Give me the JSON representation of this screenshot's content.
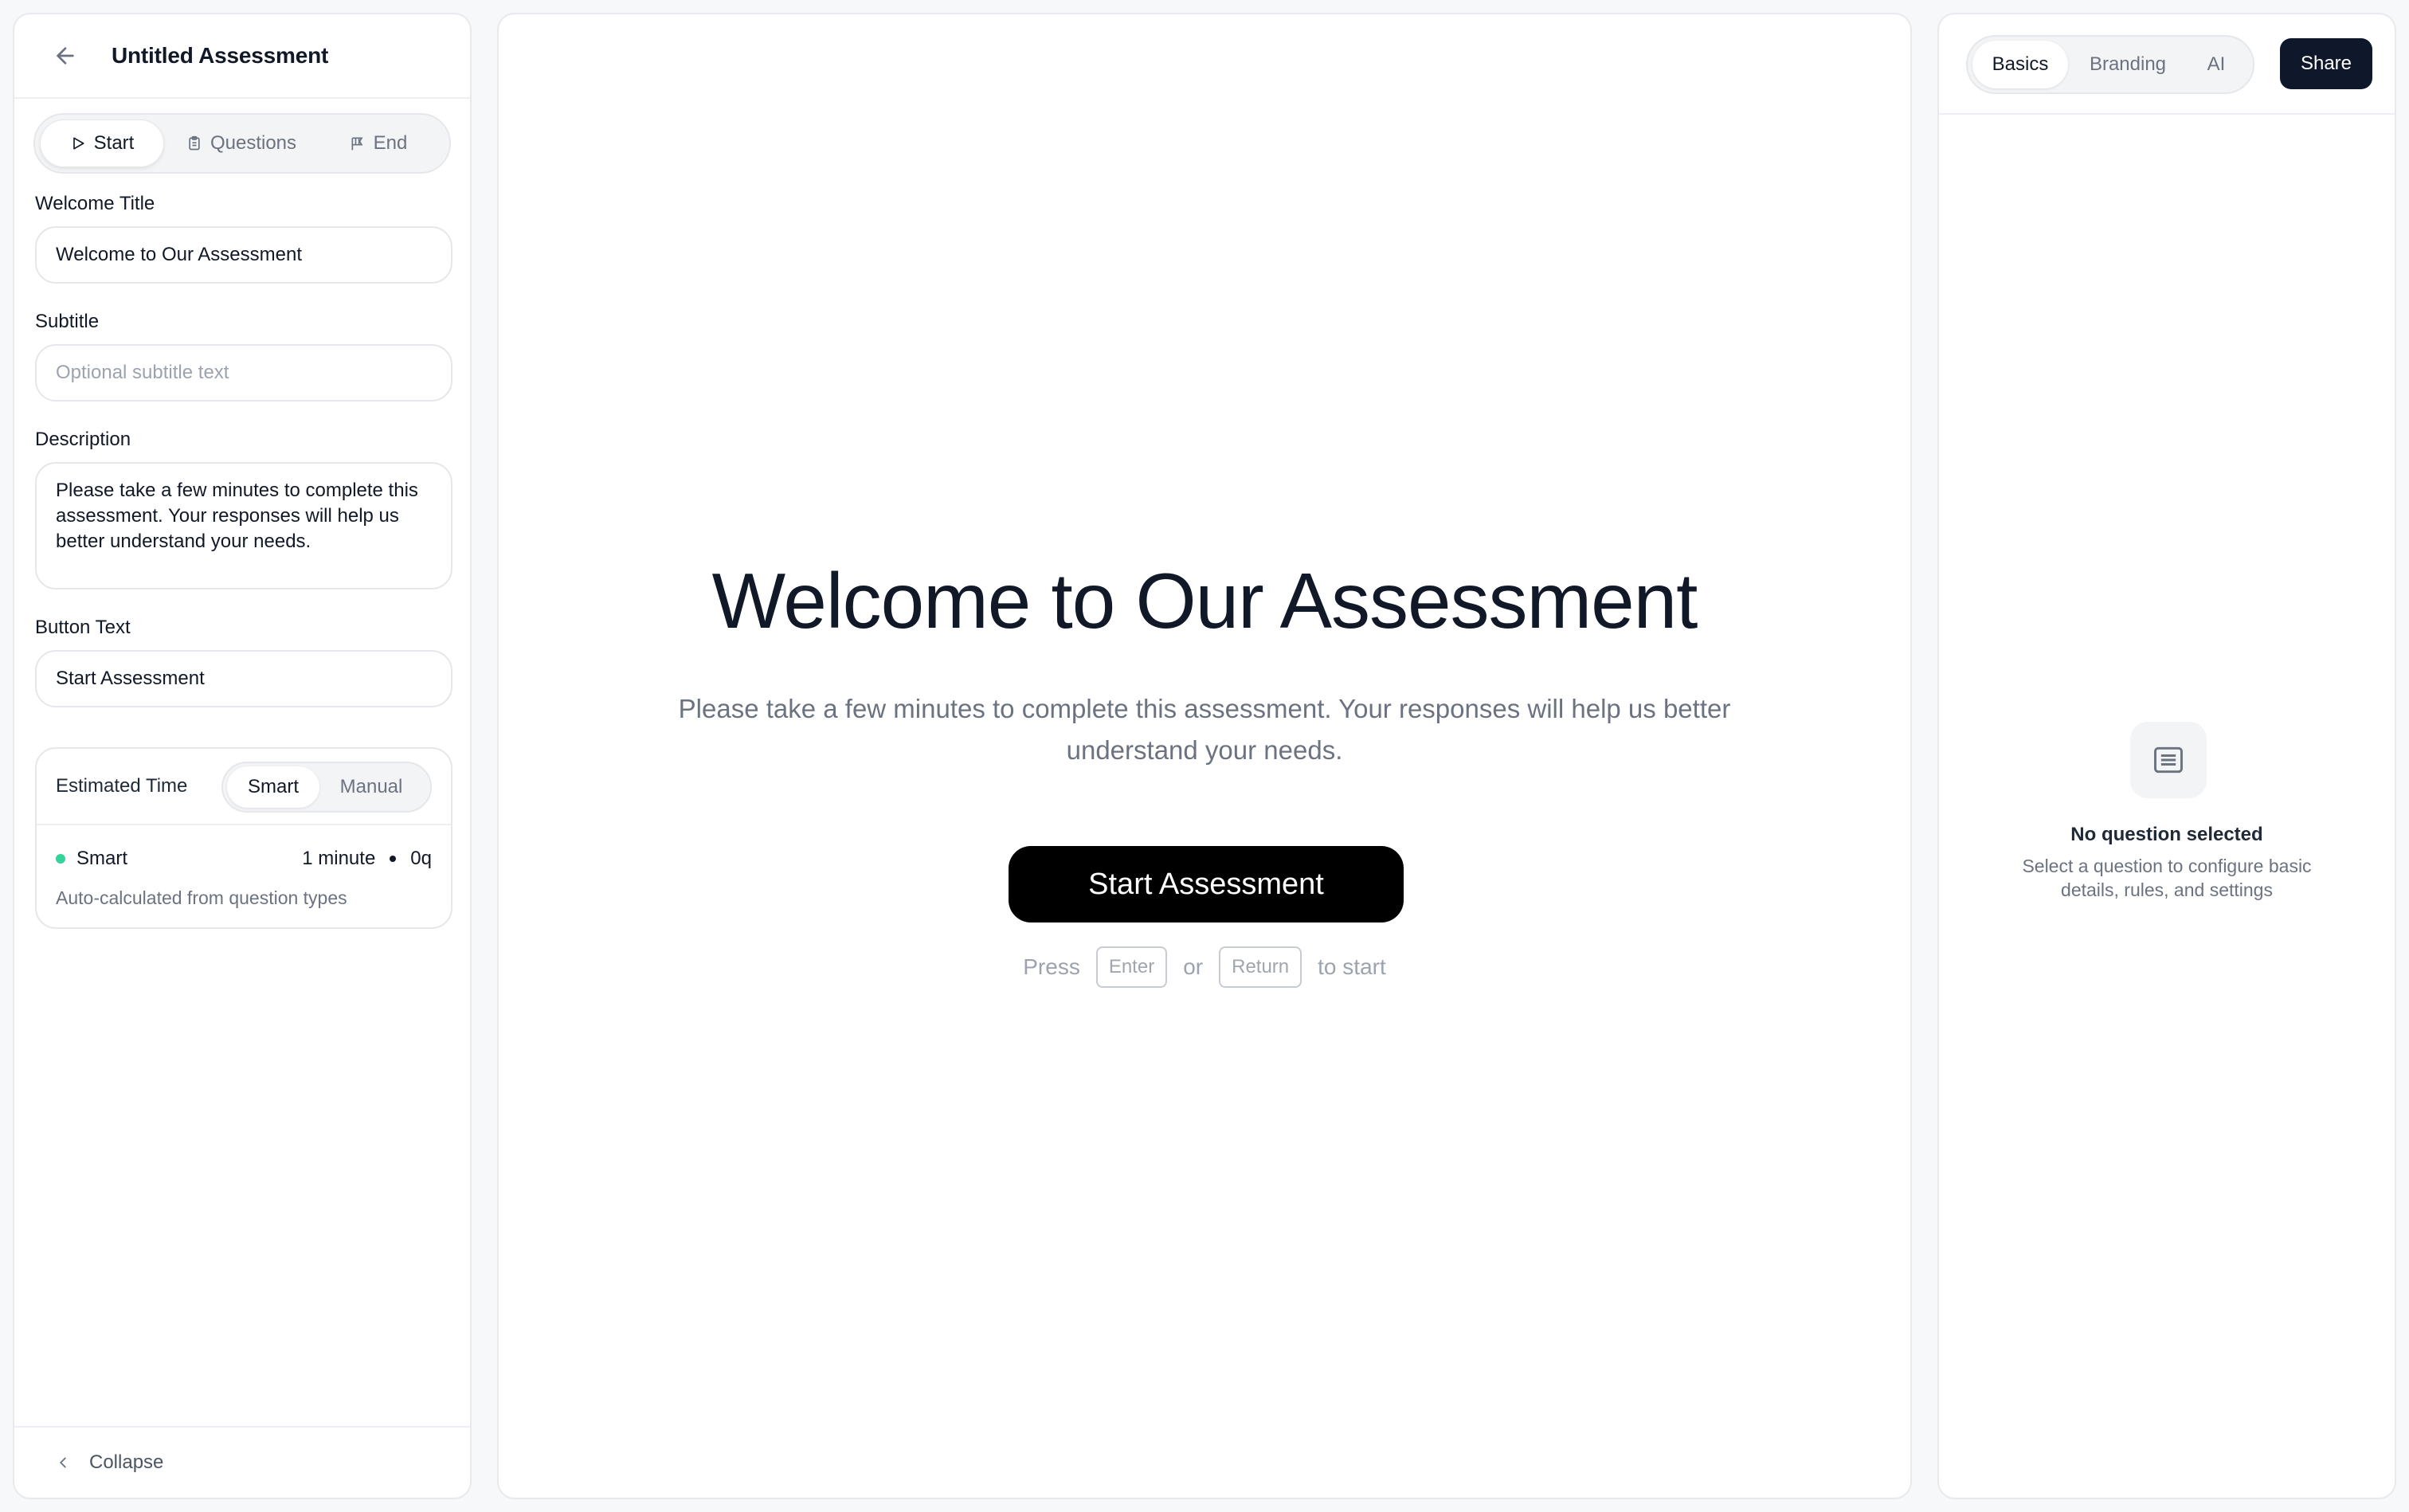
{
  "editor": {
    "title": "Untitled Assessment",
    "tabs": [
      {
        "label": "Start",
        "icon": "play-icon"
      },
      {
        "label": "Questions",
        "icon": "clipboard-icon"
      },
      {
        "label": "End",
        "icon": "flag-icon"
      }
    ],
    "welcome_title_label": "Welcome Title",
    "welcome_title_value": "Welcome to Our Assessment",
    "subtitle_label": "Subtitle",
    "subtitle_placeholder": "Optional subtitle text",
    "description_label": "Description",
    "description_value": "Please take a few minutes to complete this assessment. Your responses will help us better understand your needs.",
    "button_text_label": "Button Text",
    "button_text_value": "Start Assessment",
    "estimated_time": {
      "label": "Estimated Time",
      "options": [
        "Smart",
        "Manual"
      ],
      "selected": "Smart",
      "mode": "Smart",
      "duration": "1 minute",
      "question_count": "0q",
      "note": "Auto-calculated from question types",
      "status_color": "#34d399"
    },
    "collapse_label": "Collapse"
  },
  "preview": {
    "title": "Welcome to Our Assessment",
    "description": "Please take a few minutes to complete this assessment. Your responses will help us better understand your needs.",
    "button": "Start Assessment",
    "hint_press": "Press",
    "hint_key1": "Enter",
    "hint_or": "or",
    "hint_key2": "Return",
    "hint_end": "to start"
  },
  "settings": {
    "tabs": [
      "Basics",
      "Branding",
      "AI"
    ],
    "active_tab": "Basics",
    "share_label": "Share",
    "empty_title": "No question selected",
    "empty_desc": "Select a question to configure basic details, rules, and settings"
  },
  "colors": {
    "primary_button": "#000000",
    "share_button": "#0f172a"
  }
}
